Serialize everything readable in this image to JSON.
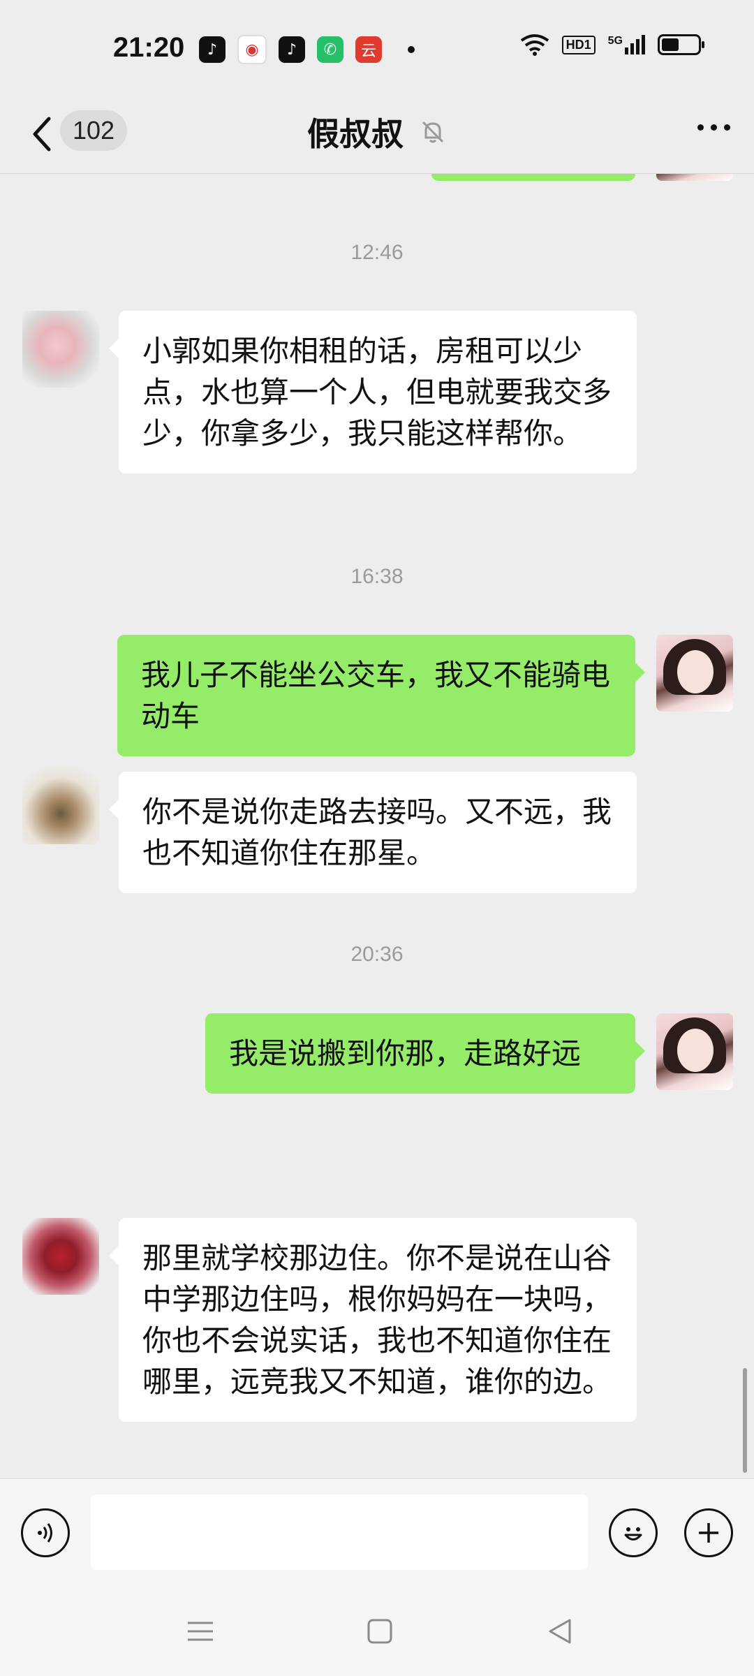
{
  "status_bar": {
    "time": "21:20",
    "app_icons": [
      "douyin-icon",
      "news-icon",
      "douyin-icon",
      "phone-icon",
      "app-icon"
    ],
    "hd_label": "HD1",
    "network_label": "5G"
  },
  "header": {
    "back_count": "102",
    "title": "假叔叔"
  },
  "messages": [
    {
      "type": "time",
      "text": "12:46"
    },
    {
      "type": "left",
      "text": "小郭如果你相租的话，房租可以少点，水也算一个人，但电就要我交多少，你拿多少，我只能这样帮你。"
    },
    {
      "type": "time",
      "text": "16:38"
    },
    {
      "type": "right",
      "text": "我儿子不能坐公交车，我又不能骑电动车"
    },
    {
      "type": "left",
      "text": "你不是说你走路去接吗。又不远，我也不知道你住在那星。"
    },
    {
      "type": "time",
      "text": "20:36"
    },
    {
      "type": "right",
      "text": "我是说搬到你那，走路好远"
    },
    {
      "type": "left",
      "text": "那里就学校那边住。你不是说在山谷中学那边住吗，根你妈妈在一块吗，你也不会说实话，我也不知道你住在哪里，远竞我又不知道，谁你的边。"
    }
  ],
  "input": {
    "placeholder": ""
  }
}
